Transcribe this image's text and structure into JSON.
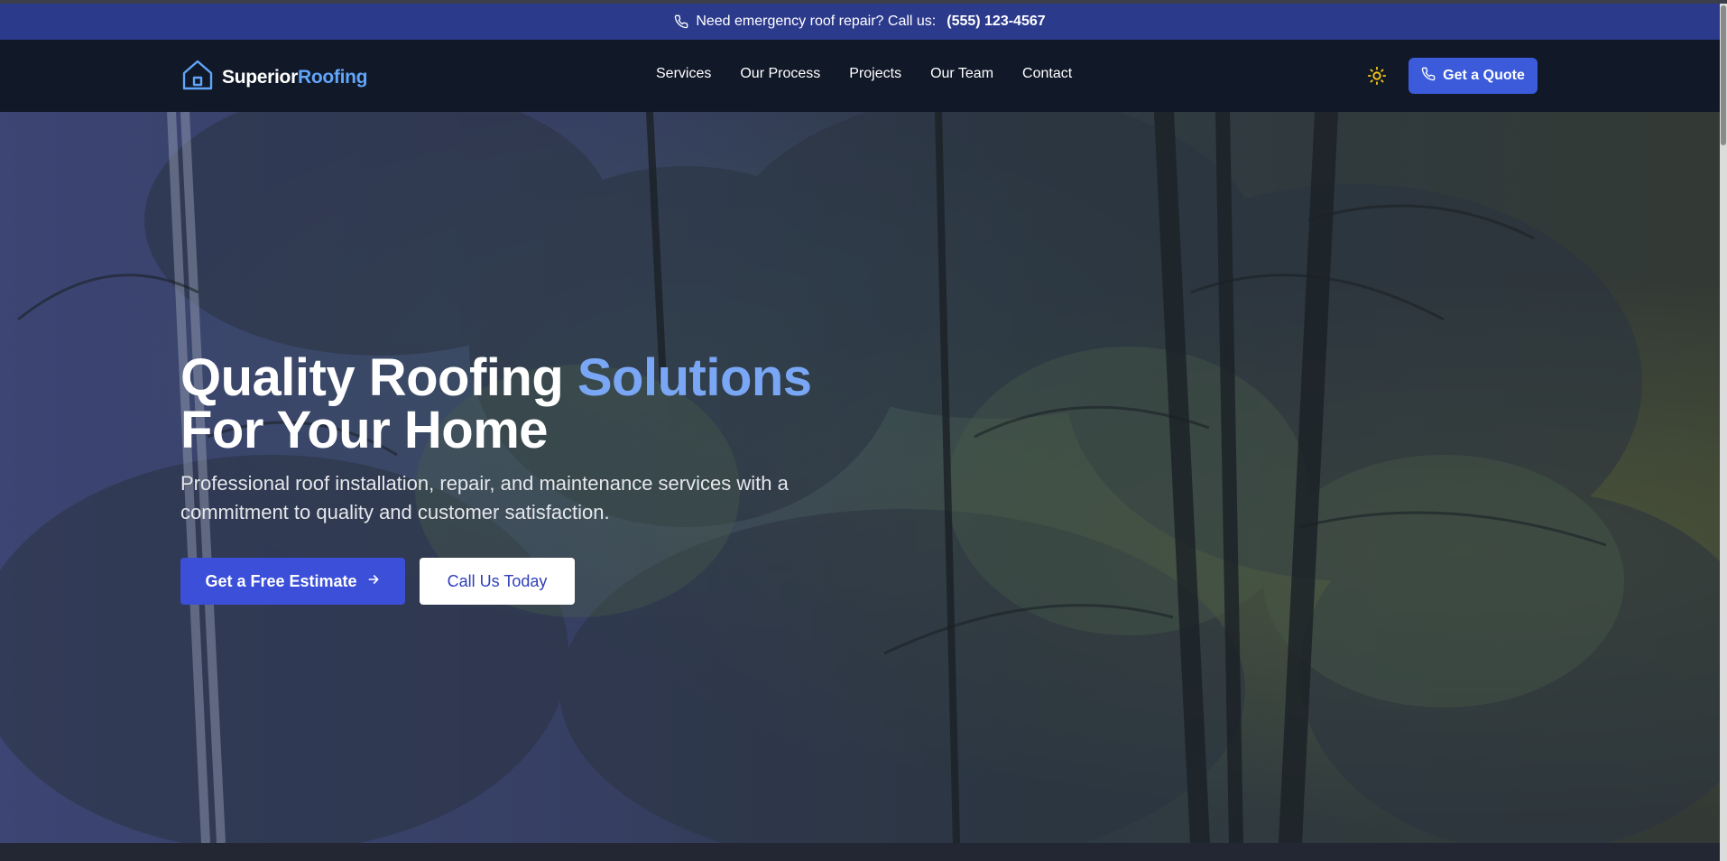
{
  "announcement": {
    "text": "Need emergency roof repair? Call us:",
    "phone": "(555) 123-4567"
  },
  "brand": {
    "name_primary": "Superior",
    "name_accent": "Roofing"
  },
  "nav": {
    "items": [
      {
        "label": "Services"
      },
      {
        "label": "Our Process"
      },
      {
        "label": "Projects"
      },
      {
        "label": "Our Team"
      },
      {
        "label": "Contact"
      }
    ],
    "quote_label": "Get a Quote"
  },
  "hero": {
    "title_part1": "Quality Roofing ",
    "title_accent": "Solutions",
    "title_part2": "For Your Home",
    "subtitle": "Professional roof installation, repair, and maintenance services with a commitment to quality and customer satisfaction.",
    "primary_cta": "Get a Free Estimate",
    "secondary_cta": "Call Us Today"
  },
  "icons": {
    "phone": "phone-icon",
    "home": "house-logo-icon",
    "theme": "sun-icon",
    "arrow": "arrow-right-icon"
  },
  "colors": {
    "announcement_bg": "#2c3a8c",
    "nav_bg": "#111827",
    "accent_blue": "#60a5fa",
    "button_blue": "#3b5bdb"
  }
}
